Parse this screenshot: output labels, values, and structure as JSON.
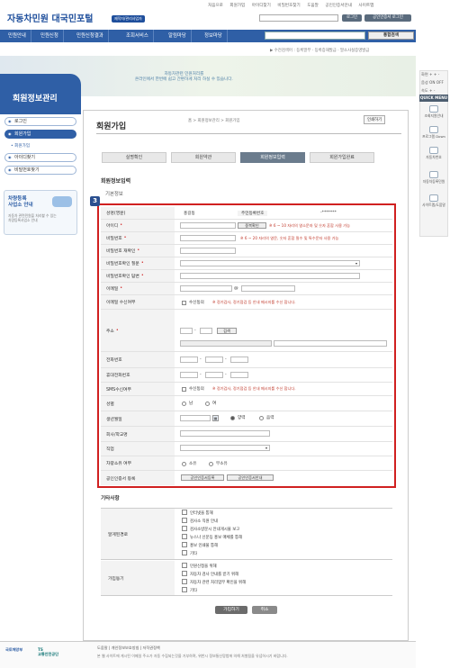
{
  "top_links": [
    "처음으로",
    "회원가입",
    "아이디찾기",
    "비밀번호찾기",
    "도움말",
    "공인인증서안내",
    "사이트맵"
  ],
  "header": {
    "logo": "자동차민원 대국민포털",
    "badge": "제작자/관리사업자",
    "login_btn": "로그인",
    "cert_login_btn": "공인인증서 로그인"
  },
  "nav": {
    "items": [
      "민원안내",
      "민원신청",
      "민원신청결과",
      "조회서비스",
      "알림마당",
      "정보마당"
    ],
    "search_btn": "통합검색"
  },
  "recent": "▶ 수전검색어 : 등록말부 · 등록증재발급 · 말소사실증명발급",
  "banner": {
    "line1": "자동차관련 민원처리를",
    "line2": "온라인에서 한번에 쉽고 간편하게 처리 하실 수 있습니다."
  },
  "sidebar": {
    "title": "회원정보관리",
    "items": [
      "로그인",
      "회원가입",
      "아이디찾기",
      "비밀번호찾기"
    ],
    "submenu": "• 회원가입",
    "car": {
      "title1": "차량등록",
      "title2": "사업소 안내",
      "desc1": "자동차 관련민원을 처리할 수 있는",
      "desc2": "차량등록사업소 안내"
    }
  },
  "page": {
    "title": "회원가입",
    "breadcrumb": "홈 > 회원정보관리 > 회원가입",
    "print": "인쇄하기",
    "steps": [
      "실명확인",
      "회원약관",
      "회원정보입력",
      "회원가입완료"
    ],
    "section": "회원정보입력",
    "subsection": "기본정보",
    "badge": "3"
  },
  "form": {
    "name_label": "성명(영문)",
    "name_value": "홍길동",
    "rrn_label": "주민등록번호",
    "rrn_value": "-*******",
    "id_label": "아이디",
    "dup_btn": "중복확인",
    "id_hint": "※ 6 ~ 10 자리의 영소문자 및 숫자 혼합 사용 가능",
    "pw_label": "비밀번호",
    "pw_hint": "※ 6 ~ 20 자리의 영문, 숫자 혼합 필수 및 특수문자 사용 가능",
    "pw2_label": "비밀번호 재확인",
    "q_label": "비밀번호확인 질문",
    "a_label": "비밀번호확인 답변",
    "email_label": "이메일",
    "at": "@",
    "email_agree_label": "이메일 수신여부",
    "agree": "수신동의",
    "email_hint": "※ 정기검사, 정기점검 등 안내 메시지를 수신 합니다.",
    "addr_label": "주소",
    "search_btn": "검색",
    "phone_label": "전화번호",
    "mobile_label": "휴대전화번호",
    "dash": "-",
    "sms_label": "SMS수신여부",
    "sms_hint": "※ 정기검사, 정기점검 등 안내 메시지를 수신 합니다.",
    "gender_label": "성별",
    "male": "남",
    "female": "여",
    "birth_label": "생년월일",
    "solar": "양력",
    "lunar": "음력",
    "company_label": "회사/학교명",
    "job_label": "직업",
    "car_label": "차량소유 여부",
    "own": "소유",
    "not_own": "무소유",
    "cert_label": "공인인증서 등록",
    "cert_btn1": "공인인증서등록",
    "cert_btn2": "공인인증서안내"
  },
  "etc": {
    "title": "기타사항",
    "route_label": "알게된경로",
    "routes": [
      "인터넷을 통해",
      "검사소 직원 안내",
      "검사소방문시 안내게시물 보고",
      "뉴스나 신문등 홍보 매체를 통해",
      "홍보 인쇄물 통해",
      "기타"
    ],
    "motive_label": "가입동기",
    "motives": [
      "민원신청을 위해",
      "자동차 검사 안내를 받기 위해",
      "자동차 관련 처리업무 확인을 위해",
      "기타"
    ]
  },
  "actions": {
    "join": "가입하기",
    "cancel": "취소"
  },
  "footer": {
    "links": "도움말  |  개인정보보호방침  |  저작권정책",
    "copy": "본 웹 사이트에 게시된 이메일 주소가 자동 수집되는것을 거부하며, 위반시 정보통신망법에 의해 처벌됨을 유념하시기 바랍니다.",
    "logo1": "국토해양부",
    "logo2a": "TS",
    "logo2b": "교통안전공단"
  },
  "right": {
    "screen": "화면 + + -",
    "sound": "음성  ON  OFF",
    "speed": "속도 + -",
    "quick": "QUICK MENU",
    "items": [
      "조회지원안내",
      "프로그램 Down",
      "자동차번호",
      "자동차등록민원",
      "사이트맵/도움말"
    ]
  }
}
